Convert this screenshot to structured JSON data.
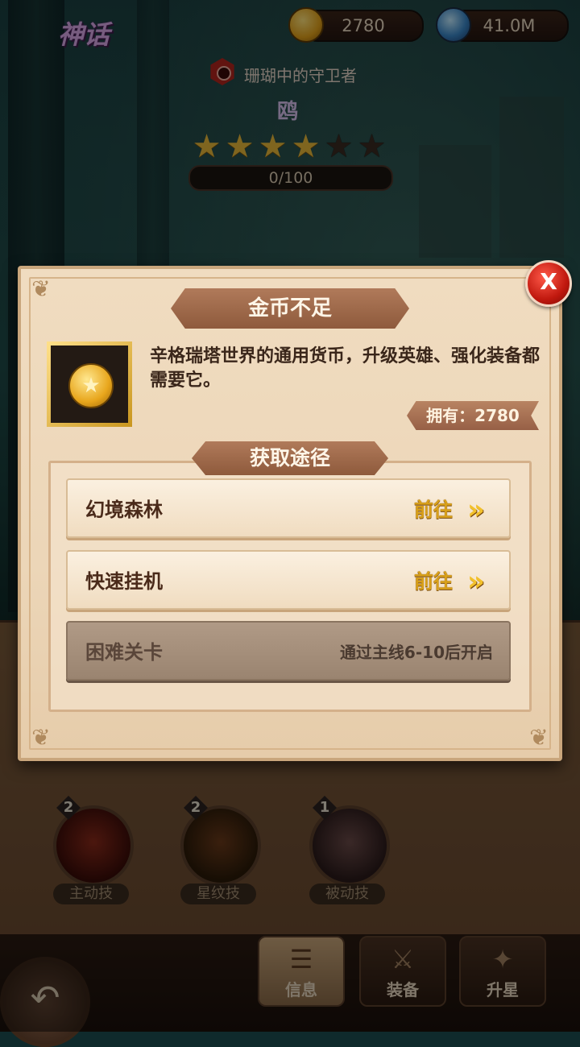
{
  "header": {
    "rarity": "神话",
    "gold": "2780",
    "gems": "41.0M"
  },
  "hero": {
    "title": "珊瑚中的守卫者",
    "name": "鸥",
    "stars_filled": 4,
    "stars_total": 6,
    "progress": "0/100"
  },
  "skills": [
    {
      "level": "2",
      "label": "主动技"
    },
    {
      "level": "2",
      "label": "星纹技"
    },
    {
      "level": "1",
      "label": "被动技"
    }
  ],
  "nav": {
    "info": "信息",
    "equip": "装备",
    "star_up": "升星"
  },
  "popup": {
    "title": "金币不足",
    "close_label": "X",
    "description": "辛格瑞塔世界的通用货币，升级英雄、强化装备都需要它。",
    "owned_label": "拥有：2780",
    "routes_title": "获取途径",
    "routes": [
      {
        "name": "幻境森林",
        "action": "前往",
        "enabled": true
      },
      {
        "name": "快速挂机",
        "action": "前往",
        "enabled": true
      },
      {
        "name": "困难关卡",
        "status": "通过主线6-10后开启",
        "enabled": false
      }
    ]
  },
  "colors": {
    "gold_text": "#d8a01a",
    "ribbon": "#9e6a4a",
    "parchment": "#ecd6b8",
    "close_red": "#c0180e"
  },
  "icons": {
    "gold": "coin-icon",
    "gems": "orb-icon",
    "faction": "faction-gem-icon",
    "close": "close-icon",
    "arrow": "chevron-right-icon",
    "back": "back-arrow-icon"
  }
}
